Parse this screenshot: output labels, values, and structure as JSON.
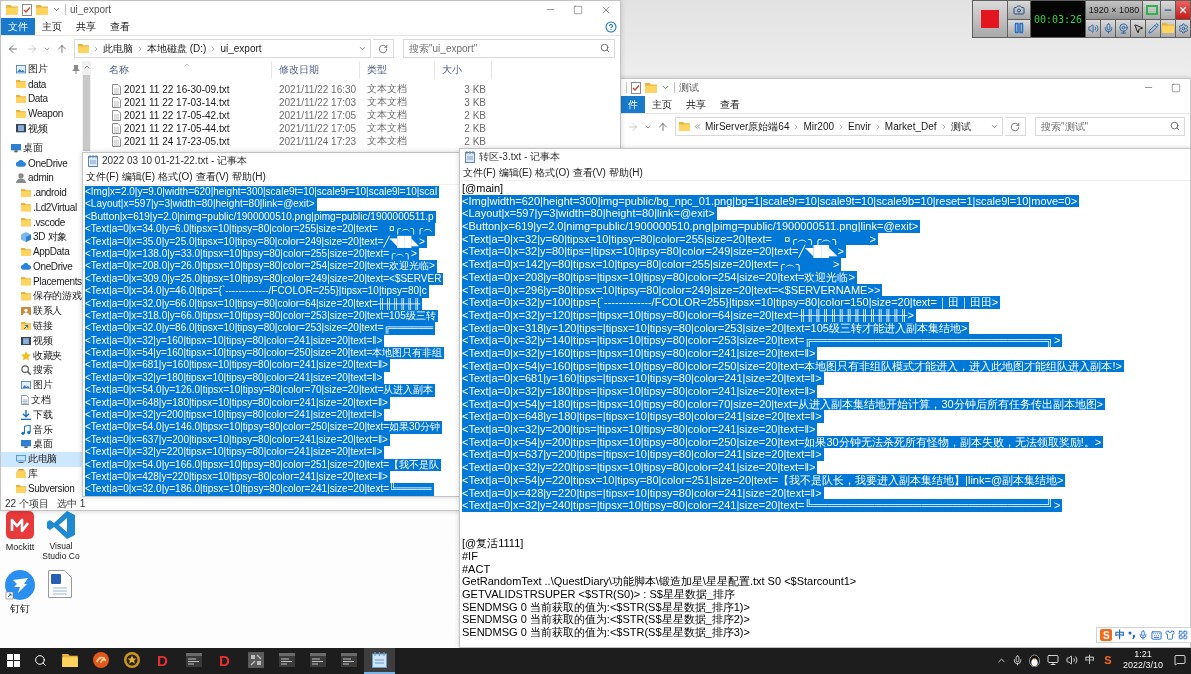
{
  "explorer_main": {
    "title": "ui_export",
    "ribbon_tabs": [
      {
        "label": "文件",
        "selected": true
      },
      {
        "label": "主页",
        "selected": false
      },
      {
        "label": "共享",
        "selected": false
      },
      {
        "label": "查看",
        "selected": false
      }
    ],
    "breadcrumb": [
      "此电脑",
      "本地磁盘 (D:)",
      "ui_export"
    ],
    "search": {
      "placeholder": "搜索\"ui_export\""
    },
    "quick_access": [
      {
        "label": "图片",
        "kind": "pictures",
        "pinned": true,
        "selected": false
      },
      {
        "label": "data",
        "kind": "folder",
        "pinned": false,
        "selected": false
      },
      {
        "label": "Data",
        "kind": "folder",
        "pinned": false,
        "selected": false
      },
      {
        "label": "Weapon",
        "kind": "folder",
        "pinned": false,
        "selected": false
      },
      {
        "label": "视频",
        "kind": "video",
        "pinned": false,
        "selected": false
      }
    ],
    "tree": [
      {
        "label": "桌面",
        "kind": "desktop",
        "selected": false,
        "children": [
          {
            "label": "OneDrive",
            "kind": "cloud",
            "selected": false
          },
          {
            "label": "admin",
            "kind": "user",
            "selected": false,
            "children": [
              {
                "label": ".android",
                "kind": "folder",
                "selected": false
              },
              {
                "label": ".Ld2Virtual",
                "kind": "folder",
                "selected": false
              },
              {
                "label": ".vscode",
                "kind": "folder",
                "selected": false
              },
              {
                "label": "3D 对象",
                "kind": "cube",
                "selected": false
              },
              {
                "label": "AppData",
                "kind": "folder",
                "selected": false
              },
              {
                "label": "OneDrive",
                "kind": "cloud",
                "selected": false
              },
              {
                "label": "Placements",
                "kind": "folder",
                "selected": false
              },
              {
                "label": "保存的游戏",
                "kind": "folder",
                "selected": false
              },
              {
                "label": "联系人",
                "kind": "contacts",
                "selected": false
              },
              {
                "label": "链接",
                "kind": "link",
                "selected": false
              },
              {
                "label": "视频",
                "kind": "video",
                "selected": false
              },
              {
                "label": "收藏夹",
                "kind": "star",
                "selected": false
              },
              {
                "label": "搜索",
                "kind": "search",
                "selected": false
              },
              {
                "label": "图片",
                "kind": "pictures",
                "selected": false
              },
              {
                "label": "文档",
                "kind": "documents",
                "selected": false
              },
              {
                "label": "下载",
                "kind": "download",
                "selected": false
              },
              {
                "label": "音乐",
                "kind": "music",
                "selected": false
              },
              {
                "label": "桌面",
                "kind": "desktop",
                "selected": false
              }
            ]
          },
          {
            "label": "此电脑",
            "kind": "pc",
            "selected": true
          },
          {
            "label": "库",
            "kind": "library",
            "selected": false
          },
          {
            "label": "Subversion",
            "kind": "folder",
            "selected": false
          }
        ]
      }
    ],
    "columns": [
      "名称",
      "修改日期",
      "类型",
      "大小"
    ],
    "files": [
      {
        "name": "2021 11 22 16-30-09.txt",
        "modified": "2021/11/22 16:30",
        "type": "文本文档",
        "size": "3 KB"
      },
      {
        "name": "2021 11 22 17-03-14.txt",
        "modified": "2021/11/22 17:03",
        "type": "文本文档",
        "size": "3 KB"
      },
      {
        "name": "2021 11 22 17-05-42.txt",
        "modified": "2021/11/22 17:05",
        "type": "文本文档",
        "size": "2 KB"
      },
      {
        "name": "2021 11 22 17-05-44.txt",
        "modified": "2021/11/22 17:05",
        "type": "文本文档",
        "size": "2 KB"
      },
      {
        "name": "2021 11 24 17-23-05.txt",
        "modified": "2021/11/24 17:23",
        "type": "文本文档",
        "size": "2 KB"
      }
    ],
    "status_bar": {
      "item_count": "22 个项目",
      "selection": "选中 1"
    }
  },
  "explorer_back": {
    "title": "测试",
    "ribbon_tabs": [
      {
        "label": "件",
        "selected": true
      },
      {
        "label": "主页",
        "selected": false
      },
      {
        "label": "共享",
        "selected": false
      },
      {
        "label": "查看",
        "selected": false
      }
    ],
    "breadcrumb": [
      "MirServer原始端64",
      "Mir200",
      "Envir",
      "Market_Def",
      "测试"
    ],
    "search": {
      "placeholder": "搜索\"测试\""
    }
  },
  "recorder": {
    "timer": "00:03:26",
    "resolution": "1920 × 1080"
  },
  "notepad_left": {
    "title": "2022 03 10 01-21-22.txt - 记事本",
    "menu": [
      "文件(F)",
      "编辑(E)",
      "格式(O)",
      "查看(V)",
      "帮助(H)"
    ],
    "sections": [
      {
        "lines": [
          {
            "text": "<Img|x=2.0|y=9.0|width=620|height=300|scale9t=10|scale9r=10|scale9l=10|scal",
            "selected": true
          },
          {
            "text": "<Layout|x=597|y=3|width=80|height=80|link=@exit>",
            "selected": true
          },
          {
            "text": "<Button|x=619|y=2.0|nimg=public/1900000510.png|pimg=public/1900000511.p",
            "selected": true
          },
          {
            "text": "<Text|a=0|x=34.0|y=6.0|tipsx=10|tipsy=80|color=255|size=20|text=    ¤╭︵╮╭︵",
            "selected": true
          },
          {
            "text": "<Text|a=0|x=35.0|y=25.0|tipsx=10|tipsy=80|color=249|size=20|text=╱◥██◣>",
            "selected": true
          },
          {
            "text": "<Text|a=0|x=138.0|y=33.0|tipsx=10|tipsy=80|color=255|size=20|text=╭︵╮>",
            "selected": true
          },
          {
            "text": "<Text|a=0|x=208.0|y=26.0|tipsx=10|tipsy=80|color=254|size=20|text=欢迎光临>",
            "selected": true
          },
          {
            "text": "<Text|a=0|x=309.0|y=25.0|tipsx=10|tipsy=80|color=249|size=20|text=<$SERVER",
            "selected": true
          },
          {
            "text": "<Text|a=0|x=34.0|y=46.0|tips={`-------------/FCOLOR=255}|tipsx=10|tipsy=80|c",
            "selected": true
          },
          {
            "text": "<Text|a=0|x=32.0|y=66.0|tipsx=10|tipsy=80|color=64|size=20|text=╫╫╫╫╫╫",
            "selected": true
          },
          {
            "text": "<Text|a=0|x=318.0|y=66.0|tipsx=10|tipsy=80|color=253|size=20|text=105级三转",
            "selected": true
          },
          {
            "text": "<Text|a=0|x=32.0|y=86.0|tipsx=10|tipsy=80|color=253|size=20|text=╔══════",
            "selected": true
          },
          {
            "text": "<Text|a=0|x=32|y=160|tipsx=10|tipsy=80|color=241|size=20|text=‖>",
            "selected": true
          },
          {
            "text": "<Text|a=0|x=54|y=160|tipsx=10|tipsy=80|color=250|size=20|text=本地图只有非组",
            "selected": true
          },
          {
            "text": "<Text|a=0|x=681|y=160|tipsx=10|tipsy=80|color=241|size=20|text=‖>",
            "selected": true
          },
          {
            "text": "<Text|a=0|x=32|y=180|tipsx=10|tipsy=80|color=241|size=20|text=‖>",
            "selected": true
          },
          {
            "text": "<Text|a=0|x=54.0|y=126.0|tipsx=10|tipsy=80|color=70|size=20|text=从进入副本",
            "selected": true
          },
          {
            "text": "<Text|a=0|x=648|y=180|tipsx=10|tipsy=80|color=241|size=20|text=‖>",
            "selected": true
          },
          {
            "text": "<Text|a=0|x=32|y=200|tipsx=10|tipsy=80|color=241|size=20|text=‖>",
            "selected": true
          },
          {
            "text": "<Text|a=0|x=54.0|y=146.0|tipsx=10|tipsy=80|color=250|size=20|text=如果30分钟",
            "selected": true
          },
          {
            "text": "<Text|a=0|x=637|y=200|tipsx=10|tipsy=80|color=241|size=20|text=‖>",
            "selected": true
          },
          {
            "text": "<Text|a=0|x=32|y=220|tipsx=10|tipsy=80|color=241|size=20|text=‖>",
            "selected": true
          },
          {
            "text": "<Text|a=0|x=54.0|y=166.0|tipsx=10|tipsy=80|color=251|size=20|text=【我不是队",
            "selected": true
          },
          {
            "text": "<Text|a=0|x=428|y=220|tipsx=10|tipsy=80|color=241|size=20|text=‖>",
            "selected": true
          },
          {
            "text": "<Text|a=0|x=32.0|y=186.0|tipsx=10|tipsy=80|color=241|size=20|text=╚═════",
            "selected": true
          }
        ]
      }
    ]
  },
  "notepad_right": {
    "title": "转区-3.txt - 记事本",
    "menu": [
      "文件(F)",
      "编辑(E)",
      "格式(O)",
      "查看(V)",
      "帮助(H)"
    ],
    "sections": [
      {
        "lines": [
          {
            "text": "[@main]",
            "selected": false
          },
          {
            "text": "<Img|width=620|height=300|img=public/bg_npc_01.png|bg=1|scale9r=10|scale9t=10|scale9b=10|reset=1|scale9l=10|move=0>",
            "selected": true
          },
          {
            "text": "<Layout|x=597|y=3|width=80|height=80|link=@exit>",
            "selected": true
          },
          {
            "text": "<Button|x=619|y=2.0|nimg=public/1900000510.png|pimg=public/1900000511.png|link=@exit>",
            "selected": true
          },
          {
            "text": "<Text|a=0|x=32|y=60|tipsx=10|tipsy=80|color=255|size=20|text=    ¤╭︵╮╭︵╮          >",
            "selected": true
          },
          {
            "text": "<Text|a=0|x=32|y=80|tips=|tipsx=10|tipsy=80|color=249|size=20|text=╱◥██◣>",
            "selected": true
          },
          {
            "text": "<Text|a=0|x=142|y=80|tipsx=10|tipsy=80|color=255|size=20|text=╭︵╮          >",
            "selected": true
          },
          {
            "text": "<Text|a=0|x=208|y=80|tips=|tipsx=10|tipsy=80|color=254|size=20|text=欢迎光临>",
            "selected": true
          },
          {
            "text": "<Text|a=0|x=296|y=80|tipsx=10|tipsy=80|color=249|size=20|text=<$SERVERNAME>>",
            "selected": true
          },
          {
            "text": "<Text|a=0|x=32|y=100|tips={`-------------/FCOLOR=255}|tipsx=10|tipsy=80|color=150|size=20|text=｜田｜田田>",
            "selected": true
          },
          {
            "text": "<Text|a=0|x=32|y=120|tips=|tipsx=10|tipsy=80|color=64|size=20|text=╫╫╫╫╫╫╫╫╫╫╫╫╫╫>",
            "selected": true
          },
          {
            "text": "<Text|a=0|x=318|y=120|tips=|tipsx=10|tipsy=80|color=253|size=20|text=105级三转才能进入副本集结地>",
            "selected": true
          },
          {
            "text": "<Text|a=0|x=32|y=140|tips=|tipsx=10|tipsy=80|color=253|size=20|text=╔══════════════════════════════╗>",
            "selected": true
          },
          {
            "text": "<Text|a=0|x=32|y=160|tips=|tipsx=10|tipsy=80|color=241|size=20|text=‖>",
            "selected": true
          },
          {
            "text": "<Text|a=0|x=54|y=160|tips=|tipsx=10|tipsy=80|color=250|size=20|text=本地图只有非组队模式才能进入，进入此地图才能组队进入副本!>",
            "selected": true
          },
          {
            "text": "<Text|a=0|x=681|y=160|tips=|tipsx=10|tipsy=80|color=241|size=20|text=‖>",
            "selected": true
          },
          {
            "text": "<Text|a=0|x=32|y=180|tips=|tipsx=10|tipsy=80|color=241|size=20|text=‖>",
            "selected": true
          },
          {
            "text": "<Text|a=0|x=54|y=180|tips=|tipsx=10|tipsy=80|color=70|size=20|text=从进入副本集结地开始计算，30分钟后所有任务传出副本地图>",
            "selected": true
          },
          {
            "text": "<Text|a=0|x=648|y=180|tips=|tipsx=10|tipsy=80|color=241|size=20|text=‖>",
            "selected": true
          },
          {
            "text": "<Text|a=0|x=32|y=200|tips=|tipsx=10|tipsy=80|color=241|size=20|text=‖>",
            "selected": true
          },
          {
            "text": "<Text|a=0|x=54|y=200|tips=|tipsx=10|tipsy=80|color=250|size=20|text=如果30分钟无法杀死所有怪物，副本失败，无法领取奖励!。>",
            "selected": true
          },
          {
            "text": "<Text|a=0|x=637|y=200|tips=|tipsx=10|tipsy=80|color=241|size=20|text=‖>",
            "selected": true
          },
          {
            "text": "<Text|a=0|x=32|y=220|tips=|tipsx=10|tipsy=80|color=241|size=20|text=‖>",
            "selected": true
          },
          {
            "text": "<Text|a=0|x=54|y=220|tipsx=10|tipsy=80|color=251|size=20|text=【我不是队长，我要进入副本集结地】|link=@副本集结地>",
            "selected": true
          },
          {
            "text": "<Text|a=0|x=428|y=220|tips=|tipsx=10|tipsy=80|color=241|size=20|text=‖>",
            "selected": true
          },
          {
            "text": "<Text|a=0|x=32|y=240|tips=|tipsx=10|tipsy=80|color=241|size=20|text=╚══════════════════════════════╝>",
            "selected": true
          }
        ]
      },
      {
        "lines": [
          {
            "text": "[@复活1111]",
            "selected": false
          },
          {
            "text": "#IF",
            "selected": false
          },
          {
            "text": "#ACT",
            "selected": false
          },
          {
            "text": "GetRandomText ..\\QuestDiary\\功能脚本\\锻造加星\\星星配置.txt S0 <$Starcount1>",
            "selected": false
          },
          {
            "text": "GETVALIDSTRSUPER <$STR(S0)> : S$星星数据_排序",
            "selected": false
          },
          {
            "text": "SENDMSG 0 当前获取的值为:<$STR(S$星星数据_排序1)>",
            "selected": false
          },
          {
            "text": "SENDMSG 0 当前获取的值为:<$STR(S$星星数据_排序2)>",
            "selected": false
          },
          {
            "text": "SENDMSG 0 当前获取的值为:<$STR(S$星星数据_排序3)>",
            "selected": false
          }
        ]
      }
    ]
  },
  "desktop_icons": [
    {
      "kind": "mockitt",
      "label": "Mockitt"
    },
    {
      "kind": "vscode",
      "label": "Visual Studio Co"
    },
    {
      "kind": "dingtalk",
      "label": "钉钉"
    },
    {
      "kind": "word"
    }
  ],
  "ime_bar": {
    "logo": "S",
    "mode": "中"
  },
  "taskbar": {
    "apps": [
      {
        "kind": "folder",
        "selected": false
      },
      {
        "kind": "swirl",
        "selected": false
      },
      {
        "kind": "emblem",
        "selected": false
      },
      {
        "kind": "letter",
        "glyph": "D",
        "selected": false
      },
      {
        "kind": "terminal",
        "selected": false
      },
      {
        "kind": "letter",
        "glyph": "D",
        "selected": false
      },
      {
        "kind": "pattern",
        "selected": false
      },
      {
        "kind": "terminal",
        "selected": false
      },
      {
        "kind": "terminal",
        "selected": false
      },
      {
        "kind": "terminal",
        "selected": false
      },
      {
        "kind": "notepad",
        "selected": true
      }
    ],
    "tray": {
      "ime_mode": "中",
      "ime_logo": "S",
      "time": "1:21",
      "date": "2022/3/10"
    }
  }
}
